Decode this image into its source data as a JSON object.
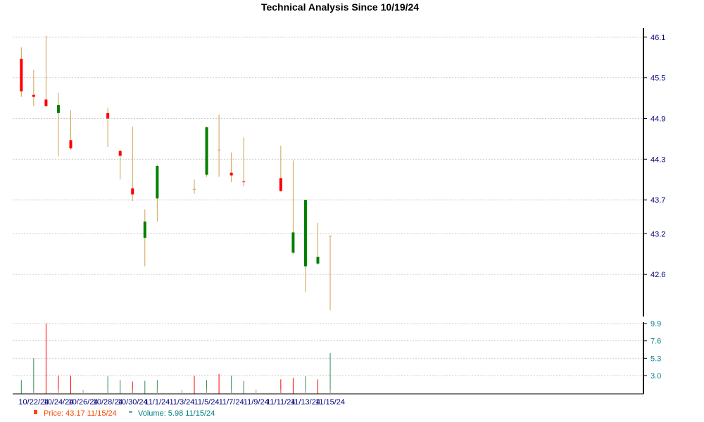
{
  "chart_data": {
    "title": "Technical Analysis Since 10/19/24",
    "price_panel": {
      "type": "candlestick",
      "y_ticks": [
        "46.1",
        "45.5",
        "44.9",
        "44.3",
        "43.7",
        "43.2",
        "42.6"
      ],
      "ylim": [
        42.0,
        46.15
      ],
      "grid": true,
      "candles": [
        {
          "date": "10/21/24",
          "open": 45.78,
          "high": 45.95,
          "low": 45.22,
          "close": 45.3
        },
        {
          "date": "10/22/24",
          "open": 45.25,
          "high": 45.62,
          "low": 45.08,
          "close": 45.22
        },
        {
          "date": "10/23/24",
          "open": 45.18,
          "high": 46.12,
          "low": 45.1,
          "close": 45.08
        },
        {
          "date": "10/24/24",
          "open": 44.98,
          "high": 45.28,
          "low": 44.34,
          "close": 45.1
        },
        {
          "date": "10/25/24",
          "open": 44.58,
          "high": 45.02,
          "low": 44.44,
          "close": 44.46
        },
        {
          "date": "10/28/24",
          "open": 44.98,
          "high": 45.06,
          "low": 44.48,
          "close": 44.9
        },
        {
          "date": "10/29/24",
          "open": 44.42,
          "high": 44.44,
          "low": 44.0,
          "close": 44.35
        },
        {
          "date": "10/30/24",
          "open": 43.87,
          "high": 44.78,
          "low": 43.68,
          "close": 43.78
        },
        {
          "date": "10/31/24",
          "open": 43.14,
          "high": 43.56,
          "low": 42.72,
          "close": 43.38
        },
        {
          "date": "11/1/24",
          "open": 43.72,
          "high": 44.22,
          "low": 43.38,
          "close": 44.2
        },
        {
          "date": "11/4/24",
          "open": 43.86,
          "high": 44.0,
          "low": 43.79,
          "close": 43.86
        },
        {
          "date": "11/5/24",
          "open": 44.07,
          "high": 44.78,
          "low": 44.04,
          "close": 44.77
        },
        {
          "date": "11/6/24",
          "open": 44.44,
          "high": 44.96,
          "low": 44.04,
          "close": 44.44
        },
        {
          "date": "11/7/24",
          "open": 44.1,
          "high": 44.4,
          "low": 43.96,
          "close": 44.06
        },
        {
          "date": "11/8/24",
          "open": 43.97,
          "high": 44.62,
          "low": 43.9,
          "close": 43.96
        },
        {
          "date": "11/11/24",
          "open": 44.02,
          "high": 44.5,
          "low": 43.82,
          "close": 43.83
        },
        {
          "date": "11/12/24",
          "open": 42.92,
          "high": 44.28,
          "low": 42.9,
          "close": 43.22
        },
        {
          "date": "11/13/24",
          "open": 42.72,
          "high": 43.7,
          "low": 42.34,
          "close": 43.7
        },
        {
          "date": "11/14/24",
          "open": 42.76,
          "high": 43.36,
          "low": 42.74,
          "close": 42.86
        },
        {
          "date": "11/15/24",
          "open": 43.17,
          "high": 43.17,
          "low": 42.07,
          "close": 43.17
        }
      ]
    },
    "volume_panel": {
      "type": "bar",
      "y_ticks": [
        "9.9",
        "7.6",
        "5.3",
        "3.0"
      ],
      "ylim": [
        2.0,
        9.9
      ],
      "bars": [
        {
          "date": "10/21/24",
          "value": 2.4,
          "dir": "up"
        },
        {
          "date": "10/22/24",
          "value": 5.3,
          "dir": "up"
        },
        {
          "date": "10/23/24",
          "value": 9.9,
          "dir": "down"
        },
        {
          "date": "10/24/24",
          "value": 3.0,
          "dir": "down"
        },
        {
          "date": "10/25/24",
          "value": 3.0,
          "dir": "down"
        },
        {
          "date": "10/28/24",
          "value": 2.9,
          "dir": "up"
        },
        {
          "date": "10/29/24",
          "value": 2.4,
          "dir": "up"
        },
        {
          "date": "10/30/24",
          "value": 2.2,
          "dir": "down"
        },
        {
          "date": "10/31/24",
          "value": 2.3,
          "dir": "up"
        },
        {
          "date": "11/1/24",
          "value": 2.4,
          "dir": "up"
        },
        {
          "date": "11/4/24",
          "value": 3.0,
          "dir": "down"
        },
        {
          "date": "11/5/24",
          "value": 2.4,
          "dir": "up"
        },
        {
          "date": "11/6/24",
          "value": 3.2,
          "dir": "down"
        },
        {
          "date": "11/7/24",
          "value": 3.0,
          "dir": "up"
        },
        {
          "date": "11/8/24",
          "value": 2.3,
          "dir": "up"
        },
        {
          "date": "11/11/24",
          "value": 2.5,
          "dir": "down"
        },
        {
          "date": "11/12/24",
          "value": 2.7,
          "dir": "down"
        },
        {
          "date": "11/13/24",
          "value": 2.9,
          "dir": "up"
        },
        {
          "date": "11/14/24",
          "value": 2.5,
          "dir": "down"
        },
        {
          "date": "11/15/24",
          "value": 5.98,
          "dir": "up"
        }
      ]
    },
    "x_axis": {
      "first_date": "10/19/24",
      "last_date": "11/15/24",
      "tick_labels": [
        "10/22/24",
        "10/24/24",
        "10/26/24",
        "10/28/24",
        "10/30/24",
        "11/1/24",
        "11/3/24",
        "11/5/24",
        "11/7/24",
        "11/9/24",
        "11/11/24",
        "11/13/24",
        "11/15/24"
      ]
    },
    "legend": {
      "price_label": "Price: 43.17  11/15/24",
      "volume_label": "Volume: 5.98  11/15/24",
      "placement": "bottom-left"
    }
  },
  "colors": {
    "up": "#008000",
    "down": "#ff0000",
    "wick": "#d2a050",
    "neutral": "#d2a050",
    "grid": "#cccccc",
    "price_axis_text": "#000080",
    "volume_axis_text": "#008080",
    "date_text": "#000080",
    "legend_price": "#ff4500",
    "legend_volume": "#008080",
    "volume_neutral": "#2e8b57"
  }
}
